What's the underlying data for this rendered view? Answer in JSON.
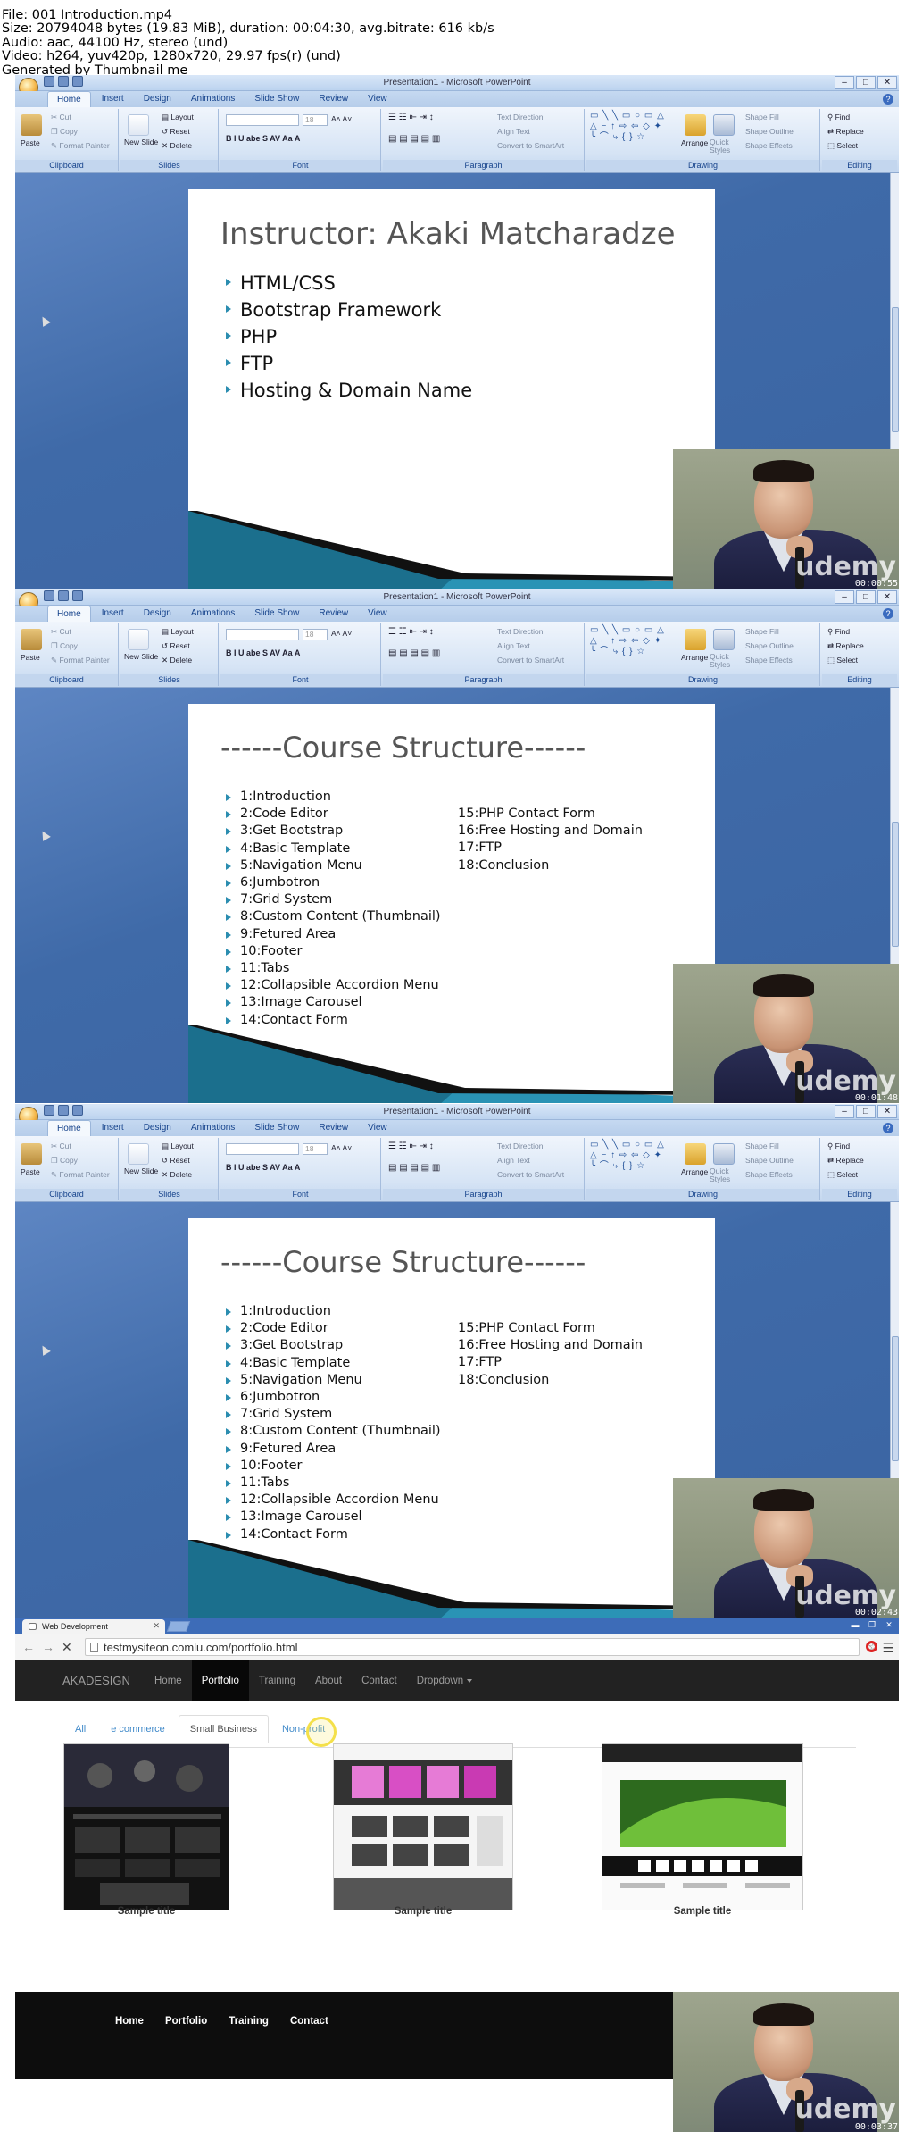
{
  "file_info": {
    "file": "File: 001 Introduction.mp4",
    "size": "Size: 20794048 bytes (19.83 MiB), duration: 00:04:30, avg.bitrate: 616 kb/s",
    "audio": "Audio: aac, 44100 Hz, stereo (und)",
    "video": "Video: h264, yuv420p, 1280x720, 29.97 fps(r) (und)",
    "generated": "Generated by Thumbnail me"
  },
  "ppt": {
    "window_title": "Presentation1 - Microsoft PowerPoint",
    "tabs": [
      "Home",
      "Insert",
      "Design",
      "Animations",
      "Slide Show",
      "Review",
      "View"
    ],
    "clipboard": {
      "paste": "Paste",
      "cut": "Cut",
      "copy": "Copy",
      "format_painter": "Format Painter",
      "label": "Clipboard"
    },
    "slides_group": {
      "new_slide": "New Slide",
      "layout": "Layout",
      "reset": "Reset",
      "delete": "Delete",
      "label": "Slides"
    },
    "font_group": {
      "size": "18",
      "label": "Font"
    },
    "paragraph_group": {
      "text_direction": "Text Direction",
      "align_text": "Align Text",
      "smartart": "Convert to SmartArt",
      "label": "Paragraph"
    },
    "drawing_group": {
      "arrange": "Arrange",
      "quick_styles": "Quick Styles",
      "shape_fill": "Shape Fill",
      "shape_outline": "Shape Outline",
      "shape_effects": "Shape Effects",
      "label": "Drawing"
    },
    "editing_group": {
      "find": "Find",
      "replace": "Replace",
      "select": "Select",
      "label": "Editing"
    }
  },
  "slide1": {
    "title": "Instructor: Akaki Matcharadze",
    "bullets": [
      "HTML/CSS",
      "Bootstrap Framework",
      "PHP",
      "FTP",
      "Hosting & Domain Name"
    ]
  },
  "course": {
    "title": "------Course Structure------",
    "col1": [
      "1:Introduction",
      "2:Code Editor",
      "3:Get Bootstrap",
      "4:Basic Template",
      "5:Navigation Menu",
      "6:Jumbotron",
      "7:Grid System",
      "8:Custom Content (Thumbnail)",
      "9:Fetured Area",
      "10:Footer",
      "11:Tabs",
      "12:Collapsible Accordion Menu",
      "13:Image Carousel",
      "14:Contact Form"
    ],
    "col2": [
      "15:PHP Contact Form",
      "16:Free Hosting and Domain",
      "17:FTP",
      "18:Conclusion"
    ]
  },
  "timestamps": [
    "00:00:55",
    "00:01:48",
    "00:02:43",
    "00:03:37"
  ],
  "logo": "udemy",
  "browser": {
    "tab_title": "Web Development",
    "url": "testmysiteon.comlu.com/portfolio.html",
    "nav": {
      "brand": "AKADESIGN",
      "items": [
        "Home",
        "Portfolio",
        "Training",
        "About",
        "Contact",
        "Dropdown"
      ],
      "active": "Portfolio"
    },
    "filters": [
      "All",
      "e commerce",
      "Small Business",
      "Non-profit"
    ],
    "active_filter": "Small Business",
    "thumbs": [
      "Sample title",
      "Sample title",
      "Sample title"
    ],
    "footer_links": [
      "Home",
      "Portfolio",
      "Training",
      "Contact"
    ]
  },
  "colors": {
    "ppt_ribbon": "#d6e4f5",
    "slide_accent": "#2b8db0",
    "nav_bg": "#222222",
    "link": "#428bca"
  }
}
